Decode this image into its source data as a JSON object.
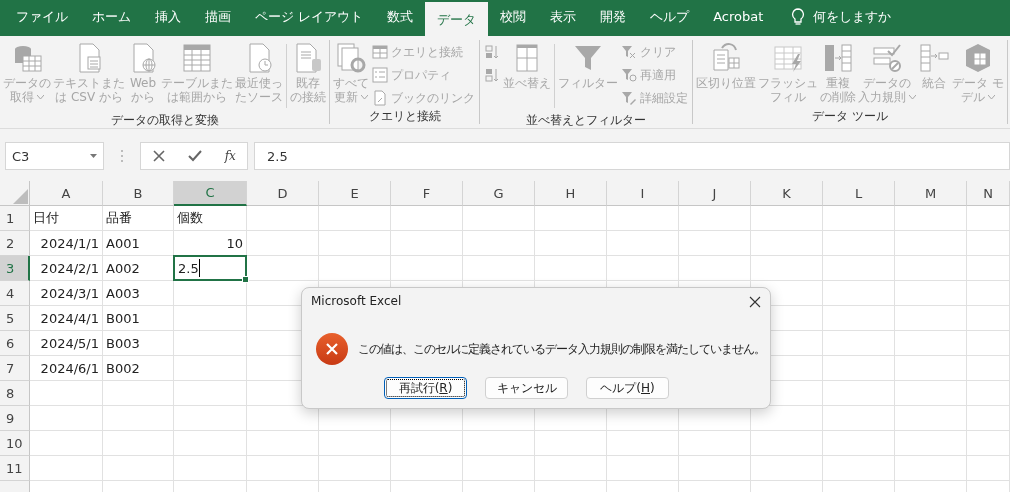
{
  "tabs": [
    {
      "label": "ファイル",
      "selected": false
    },
    {
      "label": "ホーム",
      "selected": false
    },
    {
      "label": "挿入",
      "selected": false
    },
    {
      "label": "描画",
      "selected": false
    },
    {
      "label": "ページ レイアウト",
      "selected": false
    },
    {
      "label": "数式",
      "selected": false
    },
    {
      "label": "データ",
      "selected": true
    },
    {
      "label": "校閲",
      "selected": false
    },
    {
      "label": "表示",
      "selected": false
    },
    {
      "label": "開発",
      "selected": false
    },
    {
      "label": "ヘルプ",
      "selected": false
    },
    {
      "label": "Acrobat",
      "selected": false
    }
  ],
  "tell_me": {
    "placeholder": "何をしますか"
  },
  "ribbon_groups": [
    {
      "label": "データの取得と変換",
      "items": [
        {
          "kind": "big",
          "lines": [
            "データの",
            "取得"
          ],
          "dropdown": true,
          "disabled": true
        },
        {
          "kind": "big",
          "lines": [
            "テキストまた",
            "は CSV から"
          ],
          "dropdown": false,
          "disabled": true
        },
        {
          "kind": "big",
          "lines": [
            "Web",
            "から"
          ],
          "dropdown": false,
          "disabled": true
        },
        {
          "kind": "big",
          "lines": [
            "テーブルまた",
            "は範囲から"
          ],
          "dropdown": false,
          "disabled": true
        },
        {
          "kind": "big",
          "lines": [
            "最近使っ",
            "たソース"
          ],
          "dropdown": false,
          "disabled": true
        },
        {
          "kind": "separator"
        },
        {
          "kind": "big",
          "lines": [
            "既存",
            "の接続"
          ],
          "dropdown": false,
          "disabled": true
        }
      ]
    },
    {
      "label": "クエリと接続",
      "items": [
        {
          "kind": "big",
          "lines": [
            "すべて",
            "更新"
          ],
          "dropdown": true,
          "disabled": true
        },
        {
          "kind": "stack",
          "items": [
            {
              "label": "クエリと接続",
              "disabled": true
            },
            {
              "label": "プロパティ",
              "disabled": true
            },
            {
              "label": "ブックのリンク",
              "disabled": true
            }
          ]
        }
      ]
    },
    {
      "label": "並べ替えとフィルター",
      "items": [
        {
          "kind": "stack",
          "items": [
            {
              "disabled": true
            },
            {
              "disabled": true
            }
          ]
        },
        {
          "kind": "big",
          "lines": [
            "並べ替え"
          ],
          "dropdown": false,
          "disabled": true
        },
        {
          "kind": "separator"
        },
        {
          "kind": "big",
          "lines": [
            "フィルター"
          ],
          "dropdown": false,
          "disabled": true
        },
        {
          "kind": "stack",
          "items": [
            {
              "label": "クリア",
              "disabled": true
            },
            {
              "label": "再適用",
              "disabled": true
            },
            {
              "label": "詳細設定",
              "disabled": true
            }
          ]
        }
      ]
    },
    {
      "label": "データ ツール",
      "items": [
        {
          "kind": "big",
          "lines": [
            "区切り位置"
          ],
          "dropdown": false,
          "disabled": true
        },
        {
          "kind": "big",
          "lines": [
            "フラッシュ",
            "フィル"
          ],
          "dropdown": false,
          "disabled": true
        },
        {
          "kind": "big",
          "lines": [
            "重複",
            "の削除"
          ],
          "dropdown": false,
          "disabled": true
        },
        {
          "kind": "big",
          "lines": [
            "データの",
            "入力規則"
          ],
          "dropdown": true,
          "disabled": true
        },
        {
          "kind": "big",
          "lines": [
            "統合"
          ],
          "dropdown": false,
          "disabled": true
        },
        {
          "kind": "big",
          "lines": [
            "データ モ",
            "デル"
          ],
          "dropdown": true,
          "disabled": true
        }
      ]
    }
  ],
  "formula_bar": {
    "name_box": "C3",
    "function_button": "fx",
    "value": "2.5"
  },
  "sheet": {
    "columns": [
      {
        "label": "A",
        "selected": false
      },
      {
        "label": "B",
        "selected": false
      },
      {
        "label": "C",
        "selected": true
      },
      {
        "label": "D",
        "selected": false
      },
      {
        "label": "E",
        "selected": false
      },
      {
        "label": "F",
        "selected": false
      },
      {
        "label": "G",
        "selected": false
      },
      {
        "label": "H",
        "selected": false
      },
      {
        "label": "I",
        "selected": false
      },
      {
        "label": "J",
        "selected": false
      },
      {
        "label": "K",
        "selected": false
      },
      {
        "label": "L",
        "selected": false
      },
      {
        "label": "M",
        "selected": false
      },
      {
        "label": "N",
        "selected": false
      }
    ],
    "rows": [
      {
        "label": "1",
        "selected": false,
        "cells": [
          {
            "text": "日付",
            "kind": "text"
          },
          {
            "text": "品番",
            "kind": "text"
          },
          {
            "text": "個数",
            "kind": "text"
          }
        ]
      },
      {
        "label": "2",
        "selected": false,
        "cells": [
          {
            "text": "2024/1/1",
            "kind": "number"
          },
          {
            "text": "A001",
            "kind": "text"
          },
          {
            "text": "10",
            "kind": "number"
          }
        ]
      },
      {
        "label": "3",
        "selected": true,
        "cells": [
          {
            "text": "2024/2/1",
            "kind": "number"
          },
          {
            "text": "A002",
            "kind": "text"
          },
          {
            "text": "2.5",
            "kind": "editing"
          }
        ]
      },
      {
        "label": "4",
        "selected": false,
        "cells": [
          {
            "text": "2024/3/1",
            "kind": "number"
          },
          {
            "text": "A003",
            "kind": "text"
          }
        ]
      },
      {
        "label": "5",
        "selected": false,
        "cells": [
          {
            "text": "2024/4/1",
            "kind": "number"
          },
          {
            "text": "B001",
            "kind": "text"
          }
        ]
      },
      {
        "label": "6",
        "selected": false,
        "cells": [
          {
            "text": "2024/5/1",
            "kind": "number"
          },
          {
            "text": "B003",
            "kind": "text"
          }
        ]
      },
      {
        "label": "7",
        "selected": false,
        "cells": [
          {
            "text": "2024/6/1",
            "kind": "number"
          },
          {
            "text": "B002",
            "kind": "text"
          }
        ]
      },
      {
        "label": "8",
        "selected": false,
        "cells": []
      },
      {
        "label": "9",
        "selected": false,
        "cells": []
      },
      {
        "label": "10",
        "selected": false,
        "cells": []
      },
      {
        "label": "11",
        "selected": false,
        "cells": []
      }
    ]
  },
  "dialog": {
    "title": "Microsoft Excel",
    "message": "この値は、このセルに定義されているデータ入力規則の制限を満たしていません。",
    "buttons": [
      {
        "before": "再試行(",
        "key": "R",
        "after": ")",
        "focused": true
      },
      {
        "before": "キャンセル",
        "focused": false
      },
      {
        "before": "ヘルプ(",
        "key": "H",
        "after": ")",
        "focused": false
      }
    ]
  }
}
